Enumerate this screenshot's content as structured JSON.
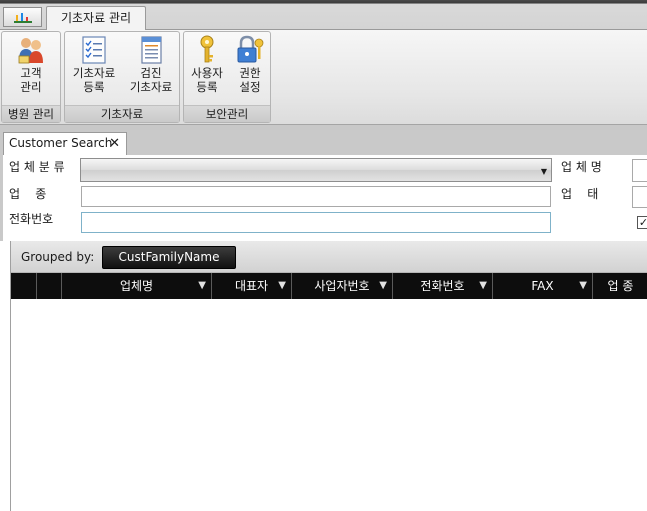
{
  "window": {
    "tab_label": "기초자료 관리"
  },
  "ribbon": {
    "groups": [
      {
        "label": "병원 관리",
        "buttons": [
          {
            "label_1": "고객",
            "label_2": "관리",
            "icon": "customers-icon"
          }
        ]
      },
      {
        "label": "기초자료",
        "buttons": [
          {
            "label_1": "기초자료",
            "label_2": "등록",
            "icon": "checklist-icon"
          },
          {
            "label_1": "검진",
            "label_2": "기초자료",
            "icon": "document-icon"
          }
        ]
      },
      {
        "label": "보안관리",
        "buttons": [
          {
            "label_1": "사용자",
            "label_2": "등록",
            "icon": "key-icon"
          },
          {
            "label_1": "권한",
            "label_2": "설정",
            "icon": "lock-key-icon"
          }
        ]
      }
    ]
  },
  "document_tab": {
    "label": "Customer Search",
    "close": "✕"
  },
  "form": {
    "biz_category_label": "업 체 분 류",
    "biz_category_value": "",
    "biz_name_label": "업 체 명",
    "biz_type_label": "업    종",
    "biz_type_value": "",
    "biz_status_label": "업    태",
    "phone_label": "전화번호",
    "phone_value": "",
    "checkbox_checked": true
  },
  "grid": {
    "grouped_by_label": "Grouped by:",
    "group_chip": "CustFamilyName",
    "columns": [
      "",
      "",
      "업체명",
      "대표자",
      "사업자번호",
      "전화번호",
      "FAX",
      "업 종"
    ],
    "filter_glyph": "▼"
  }
}
